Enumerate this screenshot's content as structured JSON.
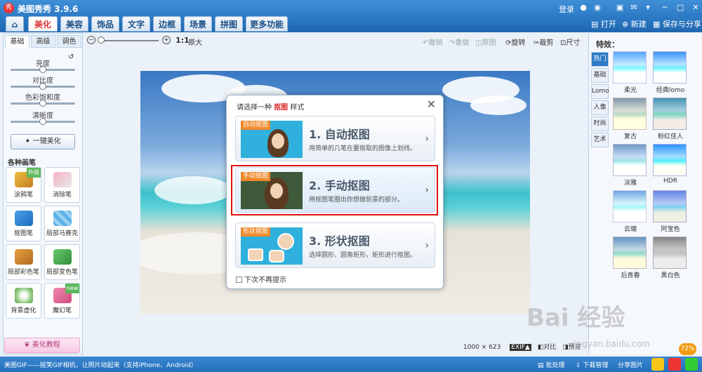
{
  "titlebar": {
    "logo": "秀",
    "title": "美图秀秀 3.9.6",
    "login": "登录"
  },
  "tabs": [
    "美化",
    "美容",
    "饰品",
    "文字",
    "边框",
    "场景",
    "拼图",
    "更多功能"
  ],
  "tab_right": {
    "open": "打开",
    "new": "新建",
    "save": "保存与分享"
  },
  "left": {
    "subtabs": [
      "基础",
      "高级",
      "调色"
    ],
    "sliders": [
      "亮度",
      "对比度",
      "色彩饱和度",
      "清晰度"
    ],
    "one_click": "一键美化",
    "section_title": "各种画笔",
    "tools": [
      "涂鸦笔",
      "消除笔",
      "抠图笔",
      "局部马赛克",
      "局部彩色笔",
      "局部变色笔",
      "背景虚化",
      "魔幻笔"
    ],
    "badges": {
      "upgrade": "升级",
      "new": "new"
    },
    "tutorial": "美化教程"
  },
  "toolbar": {
    "ratio": "1:1",
    "original": "原大",
    "undo": "撤销",
    "redo": "重做",
    "origimg": "原图",
    "rotate": "旋转",
    "crop": "裁剪",
    "size": "尺寸"
  },
  "dialog": {
    "title_pre": "请选择一种",
    "title_hl": "抠图",
    "title_post": "样式",
    "close": "✕",
    "options": [
      {
        "tag": "自动抠图",
        "title": "1. 自动抠图",
        "desc": "用简单的几笔在要抠取的图像上划线。"
      },
      {
        "tag": "手动抠图",
        "title": "2. 手动抠图",
        "desc": "用抠图笔圈出你想做前景的部分。"
      },
      {
        "tag": "形状抠图",
        "title": "3. 形状抠图",
        "desc": "选择圆形、圆角矩形，矩形进行抠图。"
      }
    ],
    "checkbox": "下次不再提示"
  },
  "right": {
    "title": "特效：",
    "cats": [
      "热门",
      "基础",
      "Lomo",
      "人像",
      "时尚",
      "艺术"
    ],
    "effects": [
      "柔光",
      "经典lomo",
      "复古",
      "粉红佳人",
      "淡雅",
      "HDR",
      "云端",
      "阿宝色",
      "后青春",
      "黑白色"
    ]
  },
  "bottom": {
    "size": "1000 × 623",
    "exif": "EXIF▲",
    "compare": "对比",
    "preview": "预览"
  },
  "status": {
    "left": "美图GIF——摇笑GIF相机，让照片动起来（支持iPhone、Android）",
    "batch": "批处理",
    "download": "下载管理",
    "share": "分享图片",
    "percent": "72%"
  },
  "watermark": {
    "main": "Bai 经验",
    "url": "jingyan.baidu.com"
  },
  "colors": {
    "accent": "#2d7bc6",
    "highlight": "#e01010"
  }
}
